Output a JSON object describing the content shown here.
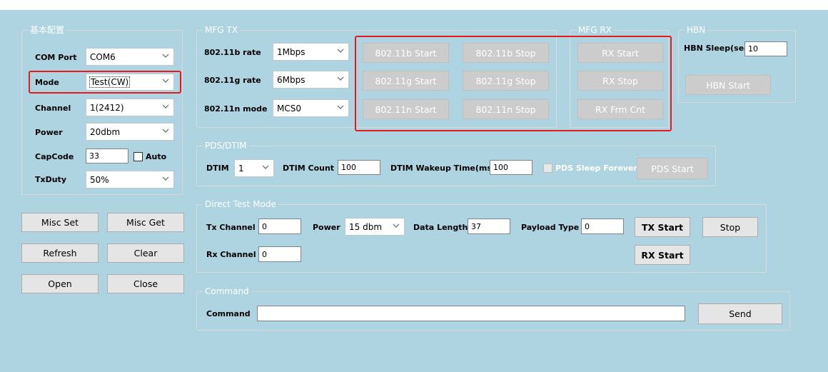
{
  "basic_config": {
    "title": "基本配置",
    "com_port": {
      "label": "COM Port",
      "value": "COM6"
    },
    "mode": {
      "label": "Mode",
      "value": "Test(CW)"
    },
    "channel": {
      "label": "Channel",
      "value": "1(2412)"
    },
    "power": {
      "label": "Power",
      "value": "20dbm"
    },
    "capcode": {
      "label": "CapCode",
      "value": "33",
      "auto_label": "Auto"
    },
    "txduty": {
      "label": "TxDuty",
      "value": "50%"
    }
  },
  "side_buttons": {
    "misc_set": "Misc Set",
    "misc_get": "Misc Get",
    "refresh": "Refresh",
    "clear": "Clear",
    "open": "Open",
    "close": "Close"
  },
  "mfg_tx": {
    "title": "MFG TX",
    "b_rate": {
      "label": "802.11b rate",
      "value": "1Mbps"
    },
    "g_rate": {
      "label": "802.11g rate",
      "value": "6Mbps"
    },
    "n_mode": {
      "label": "802.11n mode",
      "value": "MCS0"
    },
    "b_start": "802.11b Start",
    "b_stop": "802.11b Stop",
    "g_start": "802.11g Start",
    "g_stop": "802.11g Stop",
    "n_start": "802.11n Start",
    "n_stop": "802.11n Stop"
  },
  "mfg_rx": {
    "title": "MFG RX",
    "rx_start": "RX Start",
    "rx_stop": "RX Stop",
    "rx_frm_cnt": "RX Frm Cnt"
  },
  "hbn": {
    "title": "HBN",
    "sleep_label": "HBN Sleep(sec)",
    "sleep_value": "10",
    "start": "HBN Start"
  },
  "pds_dtim": {
    "title": "PDS/DTIM",
    "dtim_label": "DTIM",
    "dtim_value": "1",
    "dtim_count_label": "DTIM Count",
    "dtim_count_value": "100",
    "wakeup_label": "DTIM Wakeup Time(ms)",
    "wakeup_value": "100",
    "sleep_forever_label": "PDS Sleep Forever",
    "pds_start": "PDS Start"
  },
  "dtm": {
    "title": "Direct Test Mode",
    "tx_channel_label": "Tx Channel",
    "tx_channel_value": "0",
    "power_label": "Power",
    "power_value": "15 dbm",
    "data_length_label": "Data Length",
    "data_length_value": "37",
    "payload_label": "Payload Type",
    "payload_value": "0",
    "tx_start": "TX Start",
    "stop": "Stop",
    "rx_channel_label": "Rx Channel",
    "rx_channel_value": "0",
    "rx_start": "RX Start"
  },
  "command": {
    "title": "Command",
    "label": "Command",
    "value": "",
    "send": "Send"
  },
  "colors": {
    "background": "#aed4e2",
    "highlight": "#e51b1b",
    "disabled_button": "#cccccc"
  }
}
